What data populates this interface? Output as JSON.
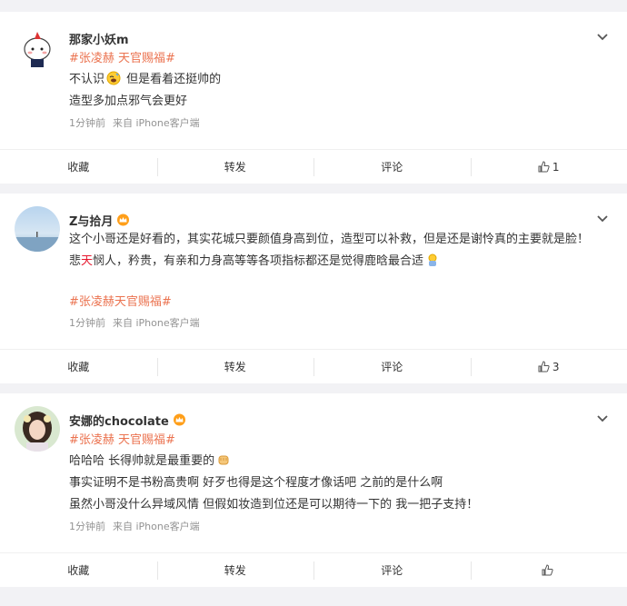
{
  "comments": [
    {
      "username": "那家小妖m",
      "tag": "#张凌赫 天官赐福#",
      "lines": [
        "不认识",
        " 但是看着还挺帅的",
        "造型多加点邪气会更好"
      ],
      "time": "1分钟前",
      "source": "来自 iPhone客户端",
      "actions": {
        "collect": "收藏",
        "repost": "转发",
        "comment": "评论",
        "like_count": "1"
      },
      "avatar_icon": "cartoon-avatar-icon"
    },
    {
      "username": "Z与拾月",
      "text_part1": "这个小哥还是好看的，其实花城只要颜值身高到位，造型可以补救，但是还是谢怜真的主要就是脸！悲",
      "text_red": "天",
      "text_part2": "悯人，矜贵，有亲和力身高等等各项指标都还是觉得鹿晗最合适",
      "tag": "#张凌赫天官赐福#",
      "time": "1分钟前",
      "source": "来自 iPhone客户端",
      "actions": {
        "collect": "收藏",
        "repost": "转发",
        "comment": "评论",
        "like_count": "3"
      },
      "avatar_icon": "landscape-avatar-icon"
    },
    {
      "username": "安娜的chocolate",
      "tag": "#张凌赫 天官赐福#",
      "lines": [
        "哈哈哈 长得帅就是最重要的",
        "事实证明不是书粉高贵啊 好歹也得是这个程度才像话吧 之前的是什么啊",
        "虽然小哥没什么异域风情 但假如妆造到位还是可以期待一下的 我一把子支持！"
      ],
      "time": "1分钟前",
      "source": "来自 iPhone客户端",
      "actions": {
        "collect": "收藏",
        "repost": "转发",
        "comment": "评论",
        "like_count": ""
      },
      "avatar_icon": "portrait-avatar-icon"
    }
  ],
  "colors": {
    "tag": "#eb7350",
    "red": "#e6162d",
    "meta": "#939393"
  }
}
